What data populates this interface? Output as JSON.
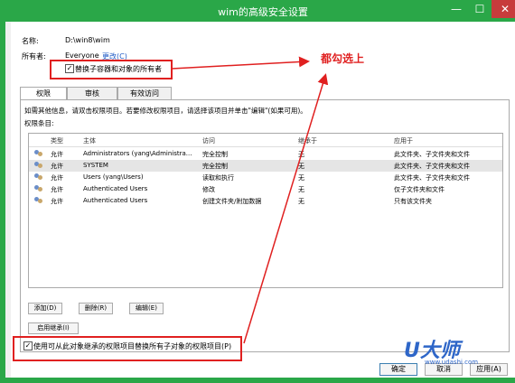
{
  "window": {
    "title": "wim的高级安全设置",
    "min": "—",
    "max": "☐",
    "close": "✕"
  },
  "info": {
    "name_label": "名称:",
    "name_value": "D:\\win8\\wim",
    "owner_label": "所有者:",
    "owner_value": "Everyone",
    "change_link": "更改(C)",
    "replace_owner": "替换子容器和对象的所有者"
  },
  "tabs": [
    "权限",
    "审核",
    "有效访问"
  ],
  "hint": "如需其他信息，请双击权限项目。若要修改权限项目，请选择该项目并单击\"编辑\"(如果可用)。",
  "perm_label": "权限条目:",
  "table": {
    "headers": [
      "类型",
      "主体",
      "访问",
      "继承于",
      "应用于"
    ],
    "rows": [
      [
        "允许",
        "Administrators (yang\\Administra...",
        "完全控制",
        "无",
        "此文件夹、子文件夹和文件"
      ],
      [
        "允许",
        "SYSTEM",
        "完全控制",
        "无",
        "此文件夹、子文件夹和文件"
      ],
      [
        "允许",
        "Users (yang\\Users)",
        "读取和执行",
        "无",
        "此文件夹、子文件夹和文件"
      ],
      [
        "允许",
        "Authenticated Users",
        "修改",
        "无",
        "仅子文件夹和文件"
      ],
      [
        "允许",
        "Authenticated Users",
        "创建文件夹/附加数据",
        "无",
        "只有该文件夹"
      ]
    ]
  },
  "buttons": {
    "add": "添加(D)",
    "remove": "删除(R)",
    "edit": "编辑(E)",
    "enable_inherit": "启用继承(I)",
    "ok": "确定",
    "cancel": "取消",
    "apply": "应用(A)"
  },
  "replace_child": "使用可从此对象继承的权限项目替换所有子对象的权限项目(P)",
  "annotation": "都勾选上",
  "watermark": {
    "logo": "U大师",
    "url": "www.udashi.com"
  },
  "colors": {
    "title_bar": "#2aa748",
    "annotation": "#e02020",
    "link": "#1f5bc6"
  }
}
